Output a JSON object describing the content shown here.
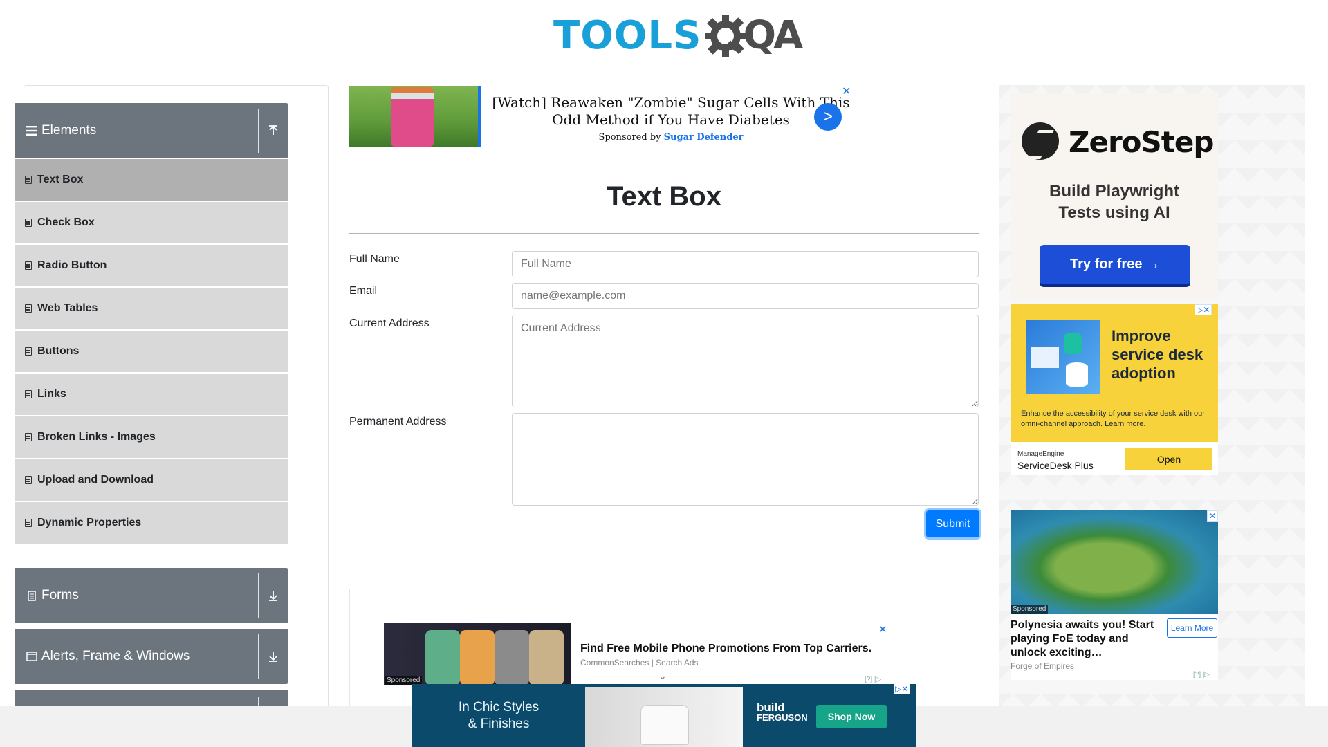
{
  "header": {
    "logo_tools": "TOOLS",
    "logo_qa": "QA"
  },
  "sidebar": {
    "groups": [
      {
        "label": "Elements",
        "icon": "hamburger-icon",
        "toggle": "collapse"
      },
      {
        "label": "Forms",
        "icon": "document-icon",
        "toggle": "expand"
      },
      {
        "label": "Alerts, Frame & Windows",
        "icon": "window-icon",
        "toggle": "expand"
      }
    ],
    "items": [
      {
        "label": "Text Box",
        "active": true
      },
      {
        "label": "Check Box"
      },
      {
        "label": "Radio Button"
      },
      {
        "label": "Web Tables"
      },
      {
        "label": "Buttons"
      },
      {
        "label": "Links"
      },
      {
        "label": "Broken Links - Images"
      },
      {
        "label": "Upload and Download"
      },
      {
        "label": "Dynamic Properties"
      }
    ]
  },
  "top_ad": {
    "headline": "[Watch] Reawaken \"Zombie\" Sugar Cells With This Odd Method if You Have Diabetes",
    "sponsored_prefix": "Sponsored by",
    "sponsor": "Sugar Defender",
    "go": ">",
    "close": "✕"
  },
  "form": {
    "title": "Text Box",
    "full_name_label": "Full Name",
    "full_name_placeholder": "Full Name",
    "email_label": "Email",
    "email_placeholder": "name@example.com",
    "current_address_label": "Current Address",
    "current_address_placeholder": "Current Address",
    "permanent_address_label": "Permanent Address",
    "submit_label": "Submit"
  },
  "phone_ad": {
    "headline": "Find Free Mobile Phone Promotions From Top Carriers.",
    "source": "CommonSearches | Search Ads",
    "sponsored": "Sponsored",
    "close": "✕",
    "adchoices": "[?] |▷"
  },
  "zerostep_ad": {
    "brand": "ZeroStep",
    "subtitle_1": "Build Playwright",
    "subtitle_2": "Tests using AI",
    "cta": "Try for free →"
  },
  "manageengine_ad": {
    "headline": "Improve service desk adoption",
    "description": "Enhance the accessibility of your service desk with our omni-channel approach. Learn more.",
    "brand_top": "ManageEngine",
    "brand_bottom": "ServiceDesk Plus",
    "cta": "Open"
  },
  "foe_ad": {
    "sponsored": "Sponsored",
    "headline": "Polynesia awaits you! Start playing FoE today and unlock exciting…",
    "cta": "Learn More",
    "source": "Forge of Empires",
    "adchoices": "[?] |▷"
  },
  "ferguson_ad": {
    "line1": "In Chic Styles",
    "line2": "& Finishes",
    "brand_1": "build",
    "brand_2": "FERGUSON",
    "cta": "Shop Now"
  },
  "colors": {
    "tools_blue": "#1aa0d8",
    "sidebar_gray": "#6c757d",
    "primary": "#007bff"
  }
}
